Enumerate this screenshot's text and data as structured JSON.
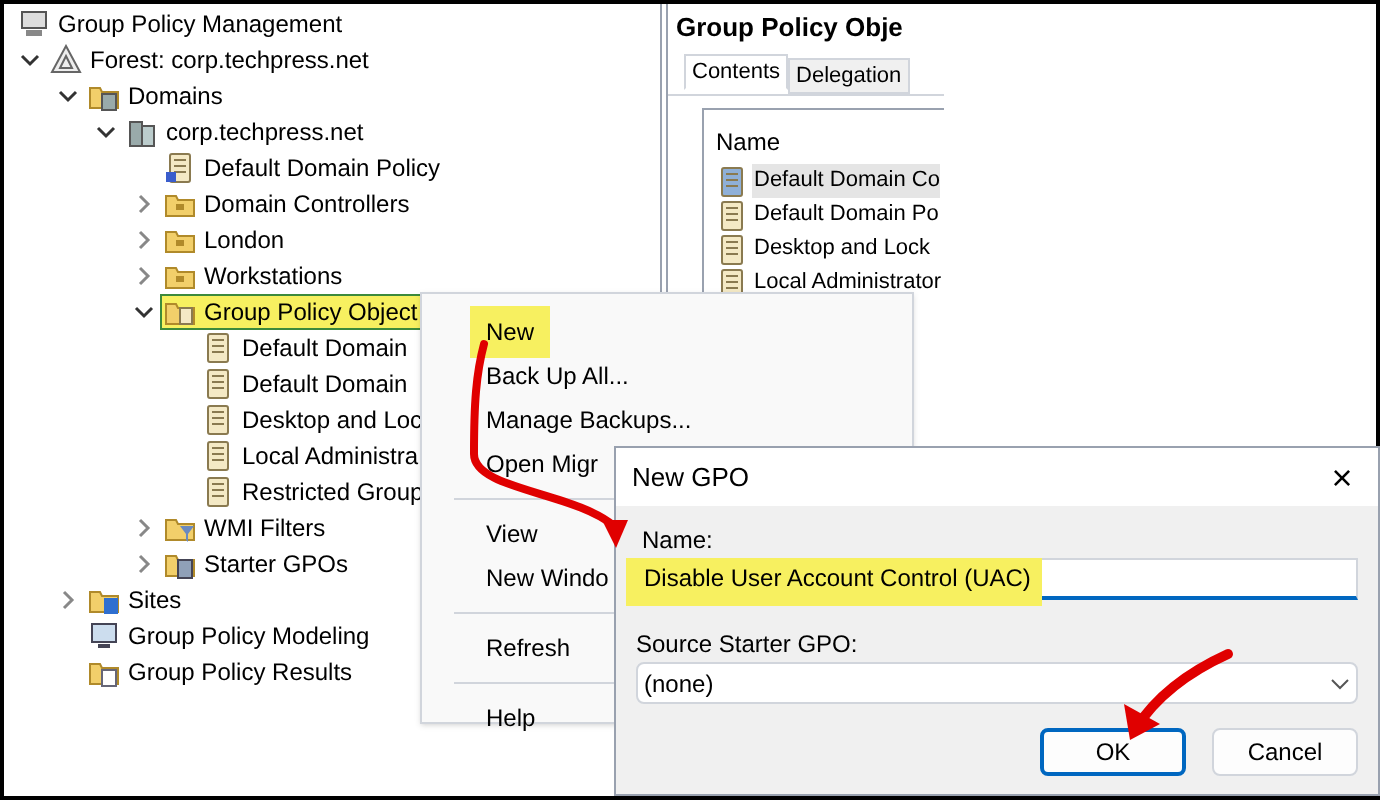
{
  "tree": [
    {
      "label": "Group Policy Management",
      "kind": "root",
      "children": [
        {
          "label": "Forest: corp.techpress.net",
          "kind": "forest",
          "expanded": true,
          "children": [
            {
              "label": "Domains",
              "kind": "domains",
              "expanded": true,
              "children": [
                {
                  "label": "corp.techpress.net",
                  "kind": "domain",
                  "expanded": true,
                  "children": [
                    {
                      "label": "Default Domain Policy",
                      "kind": "gpo-link"
                    },
                    {
                      "label": "Domain Controllers",
                      "kind": "ou",
                      "expanded": false
                    },
                    {
                      "label": "London",
                      "kind": "ou",
                      "expanded": false
                    },
                    {
                      "label": "Workstations",
                      "kind": "ou",
                      "expanded": false
                    },
                    {
                      "label": "Group Policy Object",
                      "kind": "gpo-container",
                      "expanded": true,
                      "selected": true,
                      "highlighted": true,
                      "children": [
                        {
                          "label": "Default Domain",
                          "kind": "gpo"
                        },
                        {
                          "label": "Default Domain",
                          "kind": "gpo"
                        },
                        {
                          "label": "Desktop and Loc",
                          "kind": "gpo"
                        },
                        {
                          "label": "Local Administra",
                          "kind": "gpo"
                        },
                        {
                          "label": "Restricted Group",
                          "kind": "gpo"
                        }
                      ]
                    },
                    {
                      "label": "WMI Filters",
                      "kind": "wmi",
                      "expanded": false
                    },
                    {
                      "label": "Starter GPOs",
                      "kind": "starter",
                      "expanded": false
                    }
                  ]
                }
              ]
            },
            {
              "label": "Sites",
              "kind": "sites",
              "expanded": false
            },
            {
              "label": "Group Policy Modeling",
              "kind": "modeling"
            },
            {
              "label": "Group Policy Results",
              "kind": "results"
            }
          ]
        }
      ]
    }
  ],
  "details": {
    "title": "Group Policy Obje",
    "tabs": [
      {
        "label": "Contents",
        "selected": true
      },
      {
        "label": "Delegation",
        "selected": false
      }
    ],
    "column": "Name",
    "items": [
      {
        "label": "Default Domain Co",
        "selected": true
      },
      {
        "label": "Default Domain Po",
        "selected": false
      },
      {
        "label": "Desktop and Lock",
        "selected": false
      },
      {
        "label": "Local Administrator",
        "selected": false
      }
    ]
  },
  "context_menu": [
    [
      {
        "label": "New",
        "highlighted": true
      },
      {
        "label": "Back Up All...",
        "highlighted": false
      },
      {
        "label": "Manage Backups...",
        "highlighted": false
      },
      {
        "label": "Open Migr",
        "highlighted": false
      }
    ],
    [
      {
        "label": "View",
        "highlighted": false
      },
      {
        "label": "New Windo",
        "highlighted": false
      }
    ],
    [
      {
        "label": "Refresh",
        "highlighted": false
      }
    ],
    [
      {
        "label": "Help",
        "highlighted": false
      }
    ]
  ],
  "dialog": {
    "title": "New GPO",
    "close": "×",
    "name_label": "Name:",
    "name_value": "Disable User Account Control (UAC)",
    "name_highlighted": true,
    "source_label": "Source Starter GPO:",
    "source_value": "(none)",
    "buttons": [
      {
        "label": "OK",
        "default": true
      },
      {
        "label": "Cancel",
        "default": false
      }
    ]
  }
}
